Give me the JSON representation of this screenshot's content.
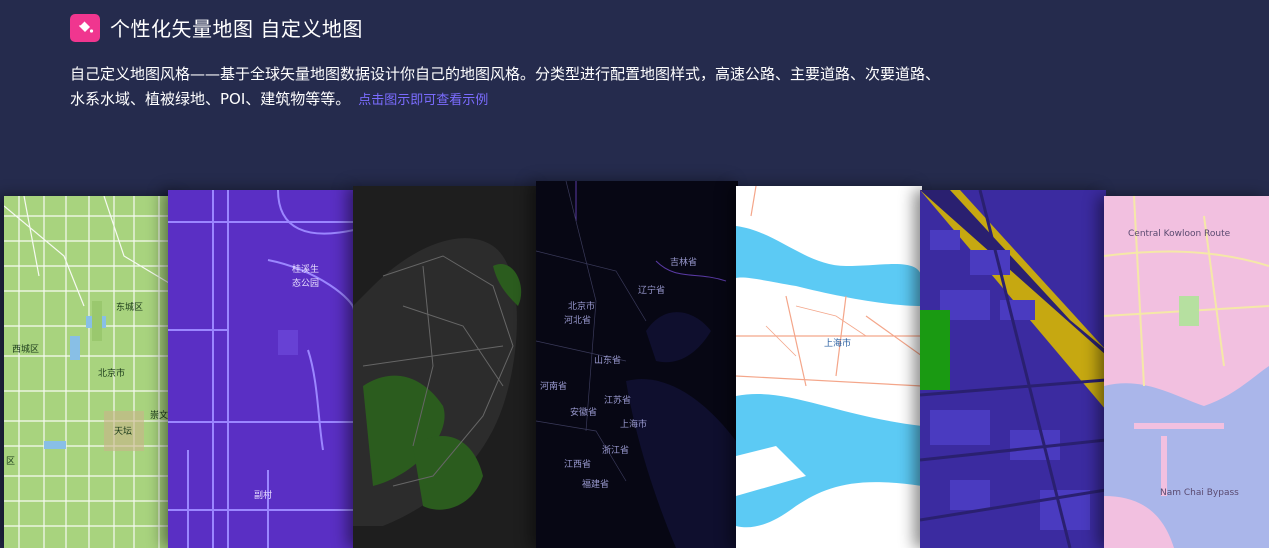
{
  "header": {
    "title": "个性化矢量地图 自定义地图",
    "logo_icon": "paint-bucket-icon",
    "accent_color": "#f0368f"
  },
  "description": {
    "text": "自己定义地图风格——基于全球矢量地图数据设计你自己的地图风格。分类型进行配置地图样式，高速公路、主要道路、次要道路、水系水域、植被绿地、POI、建筑物等等。",
    "link": "点击图示即可查看示例"
  },
  "maps": [
    {
      "style": "green-light",
      "labels": [
        "东城区",
        "西城区",
        "北京市",
        "崇文",
        "天坛",
        "区"
      ]
    },
    {
      "style": "purple",
      "labels": [
        "桂溪生",
        "态公园",
        "副村"
      ]
    },
    {
      "style": "dark-green",
      "labels": []
    },
    {
      "style": "midnight",
      "labels": [
        "吉林省",
        "辽宁省",
        "北京市",
        "河北省",
        "山东省",
        "河南省",
        "安徽省",
        "江苏省",
        "上海市",
        "浙江省",
        "江西省",
        "福建省"
      ]
    },
    {
      "style": "light-blue",
      "labels": [
        "上海市"
      ]
    },
    {
      "style": "indigo-gold",
      "labels": []
    },
    {
      "style": "pink",
      "labels": [
        "Central Kowloon Route",
        "Nam Chai Bypass"
      ]
    }
  ]
}
